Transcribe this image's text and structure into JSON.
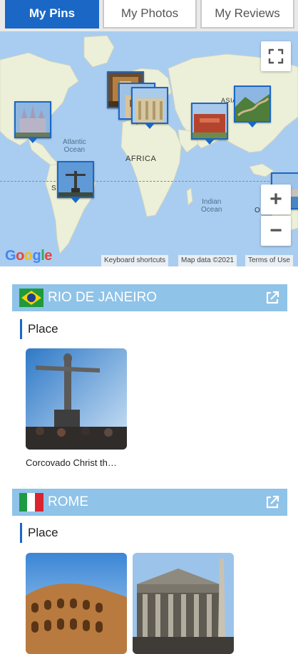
{
  "tabs": [
    {
      "label": "My Pins",
      "active": true
    },
    {
      "label": "My Photos",
      "active": false
    },
    {
      "label": "My Reviews",
      "active": false
    }
  ],
  "map": {
    "labels": {
      "atlantic": "Atlantic\nOcean",
      "africa": "AFRICA",
      "indian": "Indian\nOcean",
      "asia": "ASIA",
      "southam": "S",
      "oceania": "O"
    },
    "google_logo": "Google",
    "attribution": {
      "keyboard": "Keyboard shortcuts",
      "mapdata": "Map data ©2021",
      "terms": "Terms of Use"
    },
    "zoom_in": "+",
    "zoom_out": "−"
  },
  "sections": [
    {
      "title": "RIO DE JANEIRO",
      "flag": "brazil",
      "category": "Place",
      "cards": [
        {
          "caption": "Corcovado Christ th…"
        }
      ]
    },
    {
      "title": "ROME",
      "flag": "italy",
      "category": "Place",
      "cards": [
        {
          "caption": ""
        },
        {
          "caption": ""
        }
      ]
    }
  ],
  "colors": {
    "accent": "#1a67c6",
    "section_header": "#8fc3e8",
    "ocean": "#a9cdf0",
    "land": "#ecf0d8"
  }
}
